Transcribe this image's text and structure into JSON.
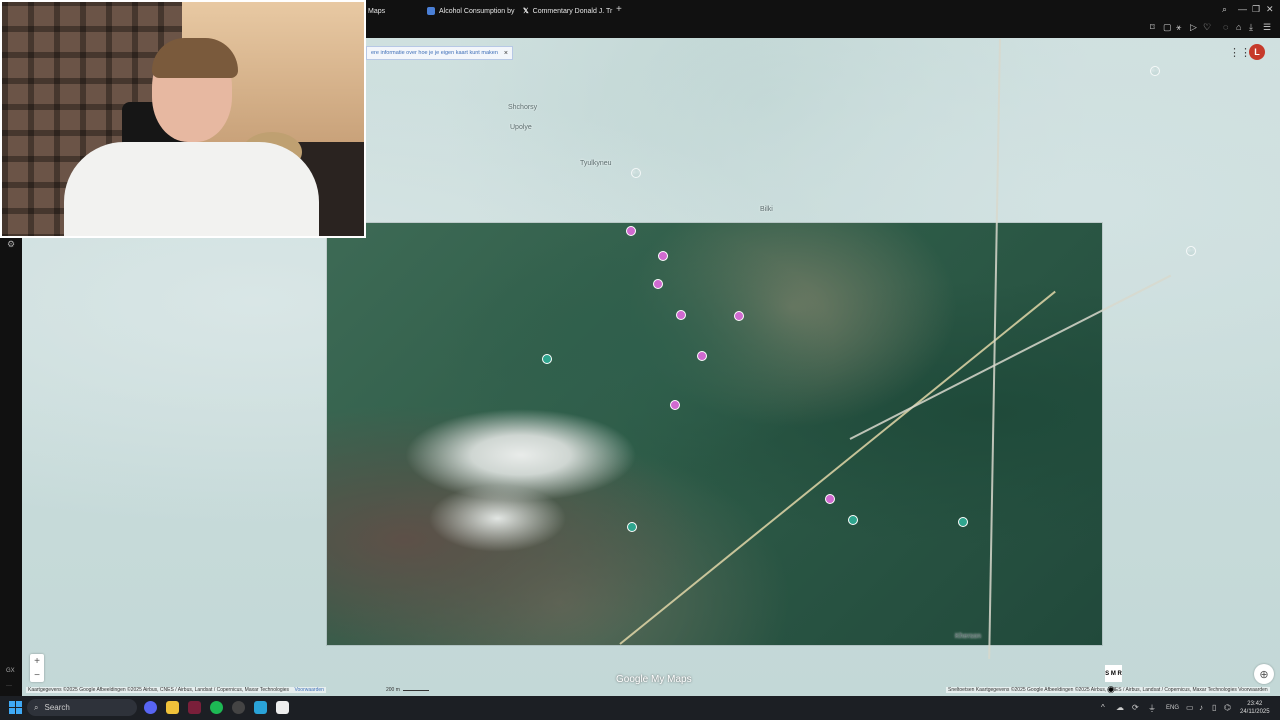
{
  "browser": {
    "tabs": [
      {
        "label": "Maps"
      },
      {
        "label": "Alcohol Consumption by"
      },
      {
        "label": "Commentary Donald J. Tr"
      }
    ],
    "new_tab": "+",
    "window_controls": [
      "—",
      "❐",
      "✕"
    ]
  },
  "map": {
    "info_banner": "ere informatie over hoe je je eigen kaart kunt maken",
    "info_close": "×",
    "avatar_letter": "L",
    "zoom_in": "+",
    "zoom_out": "−",
    "logo": "Google My Maps",
    "labels": [
      "Shchorsy",
      "Upolye",
      "Tyulkyneu",
      "Bilki",
      "Kherson"
    ],
    "attribution_left": "Kaartgegevens ©2025 Google Afbeeldingen ©2025 Airbus, CNES / Airbus, Landsat / Copernicus, Maxar Technologies",
    "terms_left": "Voorwaarden",
    "scale": "200 m",
    "attribution_right": "Sneltoetsen   Kaartgegevens ©2025 Google Afbeeldingen ©2025 Airbus, CNES / Airbus, Landsat / Copernicus, Maxar Technologies   Voorwaarden",
    "side_label": "GX"
  },
  "overlay": {
    "logo_text": "S M R"
  },
  "taskbar": {
    "search_placeholder": "Search",
    "language": "ENG",
    "time": "23:42",
    "date": "24/11/2025"
  },
  "colors": {
    "accent_pin": "#d06ad0",
    "avatar_bg": "#c63a2b",
    "start_blue": "#3fa9f5"
  }
}
